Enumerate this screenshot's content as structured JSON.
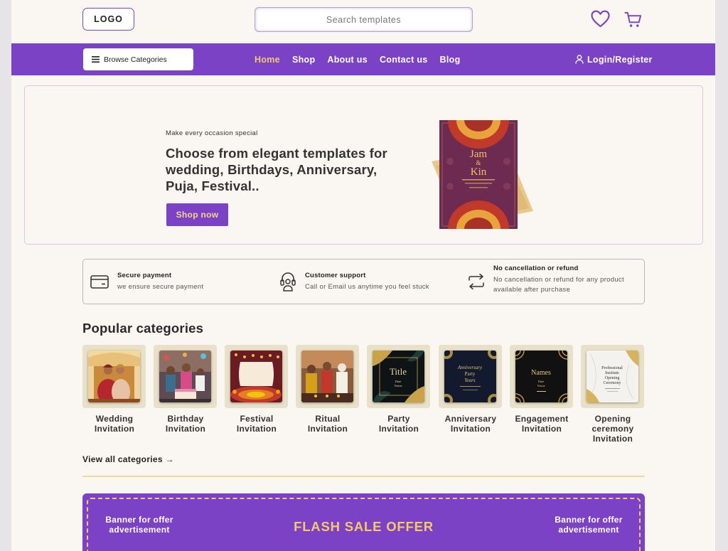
{
  "header": {
    "logo": "LOGO",
    "search_placeholder": "Search templates",
    "icons": [
      "heart-icon",
      "cart-icon"
    ]
  },
  "nav": {
    "browse_label": "Browse Categories",
    "links": [
      "Home",
      "Shop",
      "About us",
      "Contact us",
      "Blog"
    ],
    "active": "Home",
    "login": "Login/Register"
  },
  "hero": {
    "tagline": "Make every occasion special",
    "title": "Choose from elegant templates for wedding, Birthdays, Anniversary, Puja, Festival..",
    "cta": "Shop now",
    "card_text": {
      "names_top": "Jam",
      "amp": "&",
      "names_bottom": "Kin"
    }
  },
  "features": [
    {
      "icon": "card-icon",
      "title": "Secure payment",
      "desc": "we ensure secure payment"
    },
    {
      "icon": "support-icon",
      "title": "Customer support",
      "desc": "Call or Email us anytime you feel stuck"
    },
    {
      "icon": "exchange-icon",
      "title": "No cancellation or refund",
      "desc": "No cancellation or refund for any product available after purchase"
    }
  ],
  "popular": {
    "title": "Popular categories",
    "items": [
      {
        "label": "Wedding Invitation"
      },
      {
        "label": "Birthday Invitation"
      },
      {
        "label": "Festival Invitation"
      },
      {
        "label": "Ritual Invitation"
      },
      {
        "label": "Party Invitation",
        "thumb_text": "Title",
        "thumb_sub": "Date\nVenue"
      },
      {
        "label": "Anniversary Invitation",
        "thumb_text": "Anniversary Party",
        "thumb_sub": "Years"
      },
      {
        "label": "Engagement Invitation",
        "thumb_text": "Names",
        "thumb_sub": "Date\nVenue"
      },
      {
        "label": "Opening ceremony Invitation",
        "thumb_text": "Professional Institute Opening Ceremony"
      }
    ],
    "view_all": "View all categories →"
  },
  "flash": {
    "left": "Banner for offer advertisement",
    "title": "FLASH SALE OFFER",
    "right": "Banner for offer advertisement"
  },
  "colors": {
    "primary": "#7b42c6",
    "accent": "#f5c96a",
    "background": "#faf7f2"
  }
}
